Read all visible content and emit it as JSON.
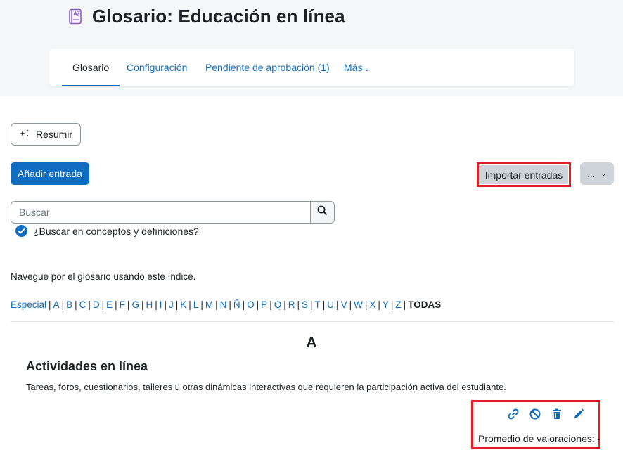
{
  "page": {
    "title": "Glosario: Educación en línea"
  },
  "tabs": [
    {
      "label": "Glosario"
    },
    {
      "label": "Configuración"
    },
    {
      "label": "Pendiente de aprobación (1)"
    },
    {
      "label": "Más"
    }
  ],
  "toolbar": {
    "summarize_label": "Resumir",
    "add_entry_label": "Añadir entrada",
    "import_label": "Importar entradas",
    "more_label": "..."
  },
  "search": {
    "placeholder": "Buscar",
    "value": "",
    "full_search_label": "¿Buscar en conceptos y definiciones?"
  },
  "browse": {
    "hint": "Navegue por el glosario usando este índice.",
    "special": "Especial",
    "letters": [
      "A",
      "B",
      "C",
      "D",
      "E",
      "F",
      "G",
      "H",
      "I",
      "J",
      "K",
      "L",
      "M",
      "N",
      "Ñ",
      "O",
      "P",
      "Q",
      "R",
      "S",
      "T",
      "U",
      "V",
      "W",
      "X",
      "Y",
      "Z"
    ],
    "all": "TODAS"
  },
  "entries": {
    "letter": "A",
    "items": [
      {
        "concept": "Actividades en línea",
        "definition": "Tareas, foros, cuestionarios, talleres u otras dinámicas interactivas que requieren la participación activa del estudiante.",
        "rating": "Promedio de valoraciones: -"
      }
    ]
  },
  "icons": {
    "title": "glossary-book-icon",
    "summarize": "sparkle-icon",
    "search": "search-icon",
    "actions": [
      "link-icon",
      "block-icon",
      "delete-icon",
      "edit-icon"
    ]
  },
  "colors": {
    "accent": "#0f6cbf",
    "highlight_border": "#e01c24",
    "secondary_button": "#ced4da",
    "header_bg": "#f5f6f8",
    "icon_purple": "#8b5ec9"
  }
}
